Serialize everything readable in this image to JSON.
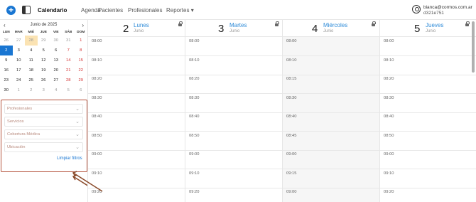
{
  "nav": {
    "items": [
      "Calendario",
      "Agenda",
      "Pacientes",
      "Profesionales",
      "Reportes"
    ],
    "reportes_caret": "▾",
    "user_email": "bianca@cormos.com.ar",
    "user_id": "d321e751"
  },
  "mini_calendar": {
    "prev": "‹",
    "next": "›",
    "title": "Junio de 2025",
    "dow": [
      "LUN",
      "MAR",
      "MIÉ",
      "JUE",
      "VIE",
      "SÁB",
      "DOM"
    ],
    "weeks": [
      [
        "26",
        "27",
        "28",
        "29",
        "30",
        "31",
        "1"
      ],
      [
        "2",
        "3",
        "4",
        "5",
        "6",
        "7",
        "8"
      ],
      [
        "9",
        "10",
        "11",
        "12",
        "13",
        "14",
        "15"
      ],
      [
        "16",
        "17",
        "18",
        "19",
        "20",
        "21",
        "22"
      ],
      [
        "23",
        "24",
        "25",
        "26",
        "27",
        "28",
        "29"
      ],
      [
        "30",
        "1",
        "2",
        "3",
        "4",
        "5",
        "6"
      ]
    ]
  },
  "filters": {
    "items": [
      "Profesionales",
      "Servicios",
      "Cobertura Médica",
      "Ubicación"
    ],
    "clear_label": "Limpiar filtros"
  },
  "columns": [
    {
      "num": "2",
      "name": "Lunes",
      "month": "Junio",
      "slots": [
        "08:00",
        "08:10",
        "08:20",
        "08:30",
        "08:40",
        "08:50",
        "09:00",
        "09:10",
        "09:20"
      ]
    },
    {
      "num": "3",
      "name": "Martes",
      "month": "Junio",
      "slots": [
        "08:00",
        "08:10",
        "08:20",
        "08:30",
        "08:40",
        "08:50",
        "09:00",
        "09:10",
        "09:20"
      ]
    },
    {
      "num": "4",
      "name": "Miércoles",
      "month": "Junio",
      "slots": [
        "08:00",
        "08:10",
        "08:15",
        "08:30",
        "08:40",
        "08:45",
        "09:00",
        "09:15",
        "09:00"
      ]
    },
    {
      "num": "5",
      "name": "Jueves",
      "month": "Junio",
      "slots": [
        "08:00",
        "08:10",
        "08:20",
        "08:30",
        "08:40",
        "08:50",
        "09:00",
        "09:10",
        "09:20"
      ]
    }
  ]
}
